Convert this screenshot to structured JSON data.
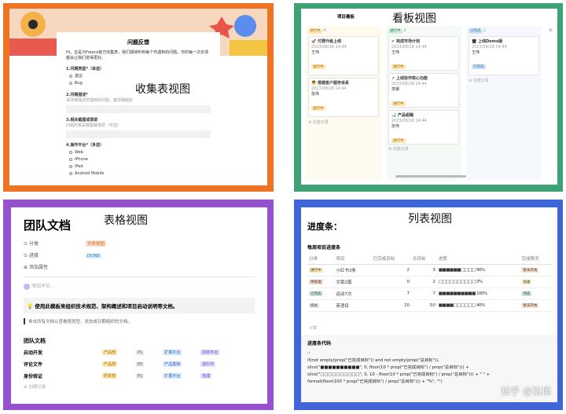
{
  "form_view": {
    "caption": "收集表视图",
    "title": "问题反馈",
    "intro": "Hi，这是为Fresco官方收集表，我们期待听到每个你遇到的问题，你的每一次反馈都会让我们变得更好。",
    "q1": "1.问题类型*（单选）",
    "q1_options": [
      "建议",
      "Bug"
    ],
    "q2": "2.问题描述*",
    "q2_hint": "请详细描述您遇到的问题，越详细越好",
    "q3": "3.相关截图或录屏",
    "q3_hint": "问题的相关截图或录屏（可选）",
    "q4": "4.操作平台*（多选）",
    "q4_options": [
      "Web",
      "iPhone",
      "iPad",
      "Android Mobile"
    ]
  },
  "kanban_view": {
    "caption": "看板视图",
    "board_title": "项目看板",
    "columns": [
      {
        "name": "进行中",
        "count": "4",
        "color": "#f5a623",
        "bg": "#fffaf0",
        "cards": [
          {
            "title": "付费升级上线",
            "date": "2023/08/18 14:44",
            "owner": "王伟",
            "status": "进行中"
          },
          {
            "title": "搭建客户服务体系",
            "date": "2023/08/18 14:44",
            "owner": "张伟",
            "status": "进行中"
          }
        ],
        "add": "创建记录"
      },
      {
        "name": "进行中",
        "count": "3",
        "color": "#3ea275",
        "bg": "#f5faf7",
        "cards": [
          {
            "title": "完成市场计划",
            "date": "2023/08/18 14:44",
            "owner": "王伟",
            "status": "进行中"
          },
          {
            "title": "上线协作核心功能",
            "date": "2023/08/18 14:44",
            "owner": "李娜",
            "status": "进行中"
          },
          {
            "title": "产品组稿",
            "date": "2023/08/18 14:44",
            "owner": "张伟",
            "status": "进行中"
          }
        ],
        "add": "创建记录"
      },
      {
        "name": "已完成",
        "count": "1",
        "color": "#3f8fd9",
        "bg": "#f5f9fd",
        "cards": [
          {
            "title": "上线Demo版",
            "date": "2023/08/18 14:44",
            "owner": "王伟",
            "status": "已完成"
          }
        ],
        "add": "创建记录"
      }
    ]
  },
  "table_view": {
    "caption": "表格视图",
    "title": "团队文档",
    "props": [
      {
        "label": "分类",
        "value": "列表视图"
      },
      {
        "label": "进度",
        "value": "DONE"
      }
    ],
    "add_prop": "添加属性",
    "comment_placeholder": "添加评论...",
    "callout": "使用此模板来组织技术规范、架构概述和项目启动说明等文档。",
    "quote": "单击所有文档以查看按类型、状态或日期组织的文档。",
    "db_title": "团队文档",
    "rows": [
      {
        "name": "启动开发",
        "tag": "产品部",
        "tag2": "P1",
        "tag3": "扩展平台",
        "tag4": "财务平台"
      },
      {
        "name": "评论文件",
        "tag": "产品部",
        "tag2": "P0",
        "tag3": "产品基础",
        "tag4": "进行中"
      },
      {
        "name": "身份验证",
        "tag": "研发部",
        "tag2": "P1",
        "tag3": "扩展平台",
        "tag4": "完成"
      }
    ],
    "new_row": "创建记录"
  },
  "list_view": {
    "caption": "列表视图",
    "heading": "进度条：",
    "db_title": "每周项目进度条",
    "headers": [
      "分类",
      "项目",
      "已完成目标",
      "总目标",
      "进度",
      "完成情况"
    ],
    "rows": [
      {
        "cat": "进行中",
        "project": "小红书3条",
        "done": "2",
        "total": "3",
        "bar": "■■■■■■□□□□ 66%",
        "fill": 0.66,
        "status": "暂未开始"
      },
      {
        "cat": "待处理",
        "project": "文章2篇",
        "done": "0",
        "total": "2",
        "bar": "□□□□□□□□□□ 0%",
        "fill": 0,
        "status": "加油"
      },
      {
        "cat": "已完成",
        "project": "运动7次",
        "done": "7",
        "total": "7",
        "bar": "■■■■■■■■■■ 100%",
        "fill": 1,
        "status": "完成"
      },
      {
        "cat": "续办",
        "project": "英语目",
        "done": "20",
        "total": "50",
        "bar": "■■■■□□□□□□ 40%",
        "fill": 0.4,
        "status": "暂未开始"
      }
    ],
    "summary": "计算",
    "code_title": "进度条代码",
    "code_lines": [
      "if(not empty(prop(\"已完成目标\")) and not empty(prop(\"总目标\")),",
      "slice(\"■■■■■■■■■■\", 0, floor(10 * prop(\"已完成目标\") / prop(\"总目标\"))) +",
      "slice(\"□□□□□□□□□□\", 0, 10 - floor(10 * prop(\"已完成目标\") / prop(\"总目标\"))) + \" \" +",
      "format(floor(100 * prop(\"已完成目标\") / prop(\"总目标\"))) + \"%\", \"\")"
    ],
    "watermark": "知乎 @洛境"
  }
}
